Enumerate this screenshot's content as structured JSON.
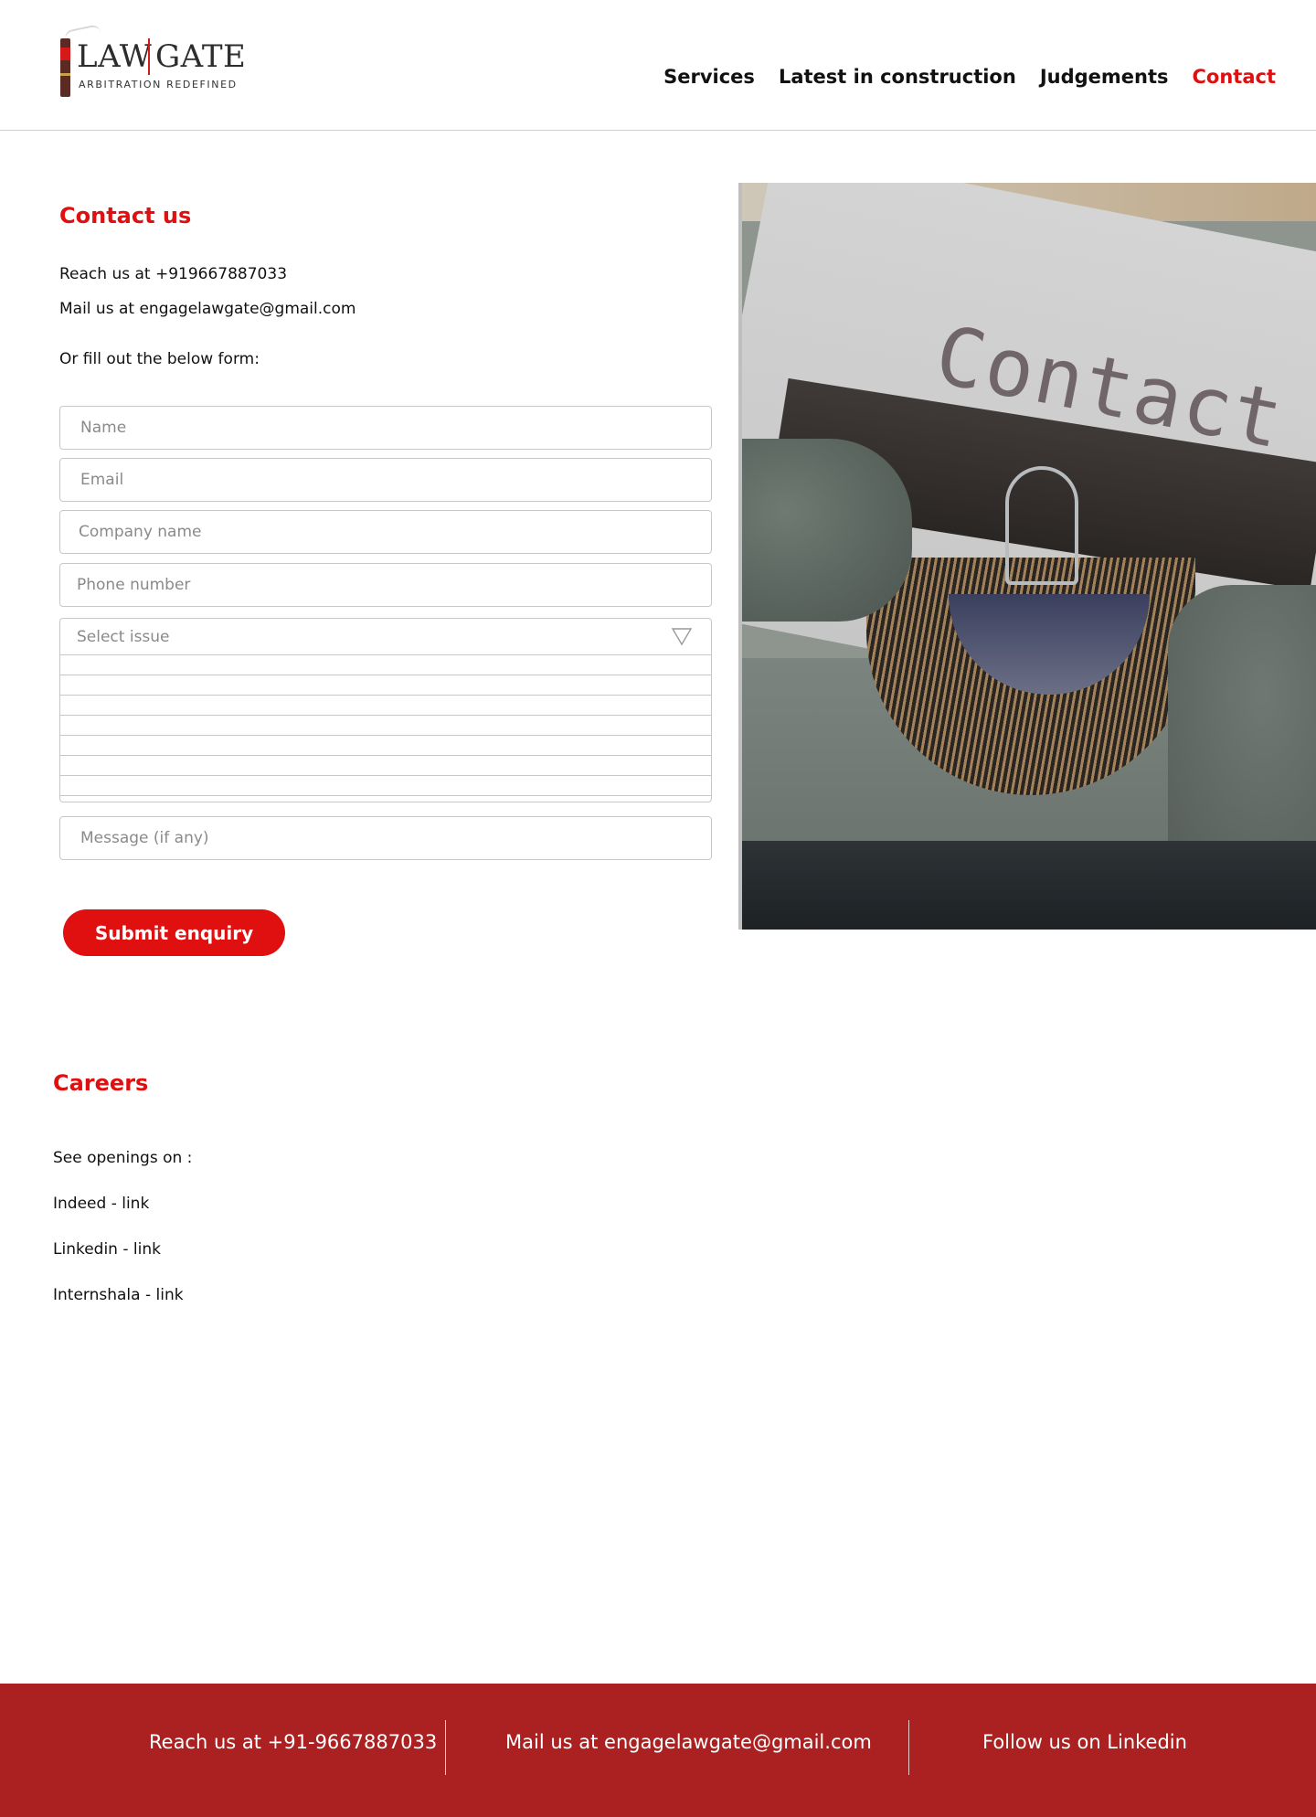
{
  "brand": {
    "name_left": "LAW",
    "name_right": "GATE",
    "tagline": "ARBITRATION REDEFINED"
  },
  "nav": {
    "items": [
      {
        "label": "Services"
      },
      {
        "label": "Latest in construction"
      },
      {
        "label": "Judgements"
      },
      {
        "label": "Contact"
      }
    ],
    "active": "Contact"
  },
  "contact": {
    "title": "Contact us",
    "phone_line": "Reach us at +919667887033",
    "mail_line": "Mail us at engagelawgate@gmail.com",
    "form_intro": "Or fill out the below form:",
    "form": {
      "name_placeholder": "Name",
      "email_placeholder": "Email",
      "company_placeholder": "Company name",
      "phone_placeholder": "Phone number",
      "issue_placeholder": "Select issue",
      "message_placeholder": "Message (if any)",
      "submit_label": "Submit enquiry"
    },
    "image_text": "Contact"
  },
  "careers": {
    "title": "Careers",
    "intro": "See openings on :",
    "links": [
      "Indeed - link",
      "Linkedin - link",
      "Internshala - link"
    ]
  },
  "footer": {
    "phone": "Reach us at +91-9667887033",
    "mail": "Mail us at engagelawgate@gmail.com",
    "follow": "Follow us on Linkedin"
  },
  "colors": {
    "accent": "#e01010",
    "footer_bg": "#ab2020"
  },
  "icons": {
    "select_caret": "triangle-down-icon"
  }
}
